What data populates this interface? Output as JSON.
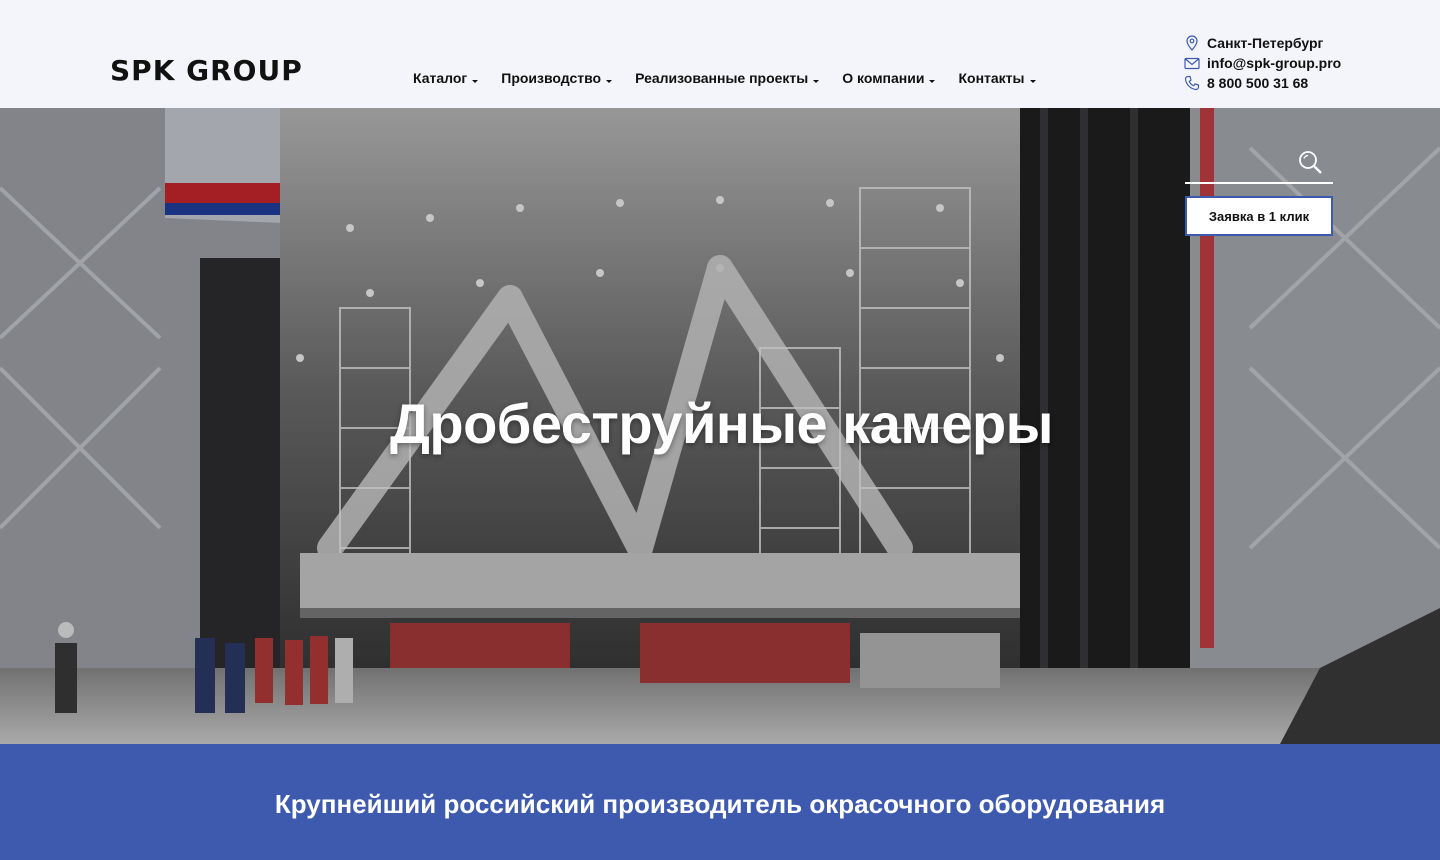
{
  "brand": {
    "logo_text": "SPK GROUP"
  },
  "nav": {
    "items": [
      {
        "label": "Каталог"
      },
      {
        "label": "Производство"
      },
      {
        "label": "Реализованные проекты"
      },
      {
        "label": "О компании"
      },
      {
        "label": "Контакты"
      }
    ]
  },
  "contacts": {
    "city": "Санкт-Петербург",
    "email": "info@spk-group.pro",
    "phone": "8 800 500 31 68",
    "icons": [
      "location-pin-icon",
      "envelope-icon",
      "phone-icon"
    ]
  },
  "hero": {
    "title": "Дробеструйные камеры",
    "search_icon": "search-icon",
    "cta_label": "Заявка в 1 клик"
  },
  "banner": {
    "text": "Крупнейший российский производитель окрасочного оборудования"
  },
  "colors": {
    "accent": "#3d5aaf",
    "header_bg": "#f4f5fa",
    "text": "#111111"
  }
}
